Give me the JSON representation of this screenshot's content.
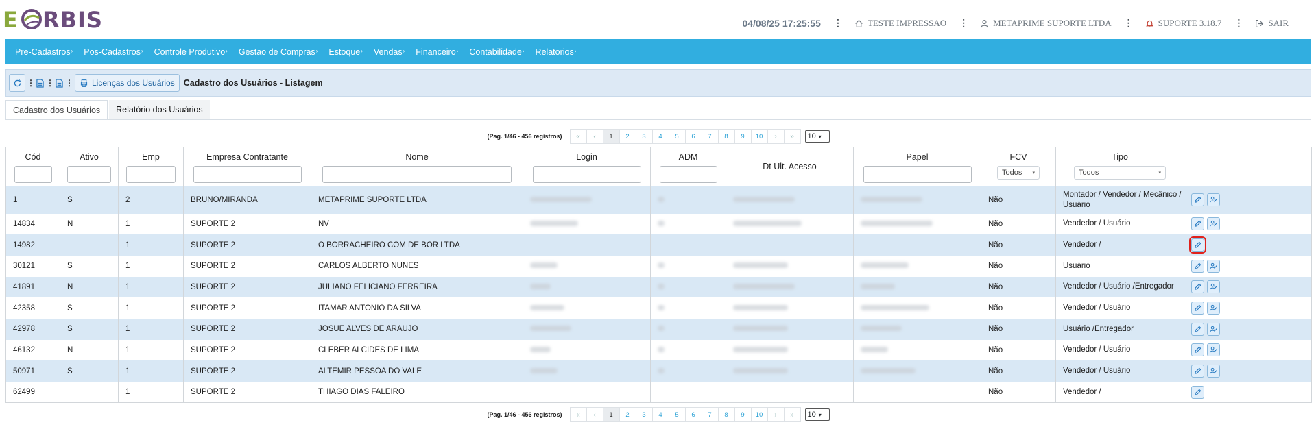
{
  "header": {
    "logo_e": "E",
    "logo_rest": "RBIS",
    "datetime": "04/08/25 17:25:55",
    "printer_label": "TESTE IMPRESSAO",
    "company_label": "METAPRIME SUPORTE LTDA",
    "support_label": "SUPORTE 3.18.7",
    "logout_label": "SAIR"
  },
  "menu": [
    "Pre-Cadastros",
    "Pos-Cadastros",
    "Controle Produtivo",
    "Gestao de Compras",
    "Estoque",
    "Vendas",
    "Financeiro",
    "Contabilidade",
    "Relatorios"
  ],
  "toolbar": {
    "licenses_label": "Licenças dos Usuários",
    "page_title": "Cadastro dos Usuários - Listagem"
  },
  "tabs": [
    "Cadastro dos Usuários",
    "Relatório dos Usuários"
  ],
  "pager": {
    "info": "(Pag. 1/46 - 456 registros)",
    "first": "«",
    "prev": "‹",
    "pages": [
      "1",
      "2",
      "3",
      "4",
      "5",
      "6",
      "7",
      "8",
      "9",
      "10"
    ],
    "next": "›",
    "last": "»",
    "page_size": "10",
    "active_page": "1"
  },
  "table": {
    "columns": [
      "Cód",
      "Ativo",
      "Emp",
      "Empresa Contratante",
      "Nome",
      "Login",
      "ADM",
      "Dt Ult. Acesso",
      "Papel",
      "FCV",
      "Tipo"
    ],
    "fcv_filter": "Todos",
    "tipo_filter": "Todos",
    "rows": [
      {
        "cod": "1",
        "ativo": "S",
        "emp": "2",
        "empresa": "BRUNO/MIRANDA",
        "nome": "METAPRIME SUPORTE LTDA",
        "fcv": "Não",
        "tipo": "Montador / Vendedor / Mecânico / Usuário"
      },
      {
        "cod": "14834",
        "ativo": "N",
        "emp": "1",
        "empresa": "SUPORTE 2",
        "nome": "NV",
        "fcv": "Não",
        "tipo": "Vendedor / Usuário"
      },
      {
        "cod": "14982",
        "ativo": "",
        "emp": "1",
        "empresa": "SUPORTE 2",
        "nome": "O BORRACHEIRO COM DE BOR LTDA",
        "fcv": "Não",
        "tipo": "Vendedor /"
      },
      {
        "cod": "30121",
        "ativo": "S",
        "emp": "1",
        "empresa": "SUPORTE 2",
        "nome": "CARLOS ALBERTO NUNES",
        "fcv": "Não",
        "tipo": "Usuário"
      },
      {
        "cod": "41891",
        "ativo": "N",
        "emp": "1",
        "empresa": "SUPORTE 2",
        "nome": "JULIANO FELICIANO FERREIRA",
        "fcv": "Não",
        "tipo": "Vendedor / Usuário /Entregador"
      },
      {
        "cod": "42358",
        "ativo": "S",
        "emp": "1",
        "empresa": "SUPORTE 2",
        "nome": "ITAMAR ANTONIO DA SILVA",
        "fcv": "Não",
        "tipo": "Vendedor / Usuário"
      },
      {
        "cod": "42978",
        "ativo": "S",
        "emp": "1",
        "empresa": "SUPORTE 2",
        "nome": "JOSUE ALVES DE ARAUJO",
        "fcv": "Não",
        "tipo": "Usuário /Entregador"
      },
      {
        "cod": "46132",
        "ativo": "N",
        "emp": "1",
        "empresa": "SUPORTE 2",
        "nome": "CLEBER ALCIDES DE LIMA",
        "fcv": "Não",
        "tipo": "Vendedor / Usuário"
      },
      {
        "cod": "50971",
        "ativo": "S",
        "emp": "1",
        "empresa": "SUPORTE 2",
        "nome": "ALTEMIR PESSOA DO VALE",
        "fcv": "Não",
        "tipo": "Vendedor / Usuário"
      },
      {
        "cod": "62499",
        "ativo": "",
        "emp": "1",
        "empresa": "SUPORTE 2",
        "nome": "THIAGO DIAS FALEIRO",
        "fcv": "Não",
        "tipo": "Vendedor /"
      }
    ]
  },
  "colors": {
    "menu_bg": "#31aee0",
    "toolbar_bg": "#dde9f5",
    "row_stripe": "#d9e8f5",
    "highlight": "#e0211b",
    "logo_green": "#8aa83c",
    "logo_purple": "#6b4c7c"
  },
  "icons": [
    "refresh-icon",
    "document-icon",
    "printer-icon",
    "home-icon",
    "user-icon",
    "bell-icon",
    "logout-icon",
    "pencil-icon",
    "user-check-icon",
    "caret-down-icon"
  ]
}
